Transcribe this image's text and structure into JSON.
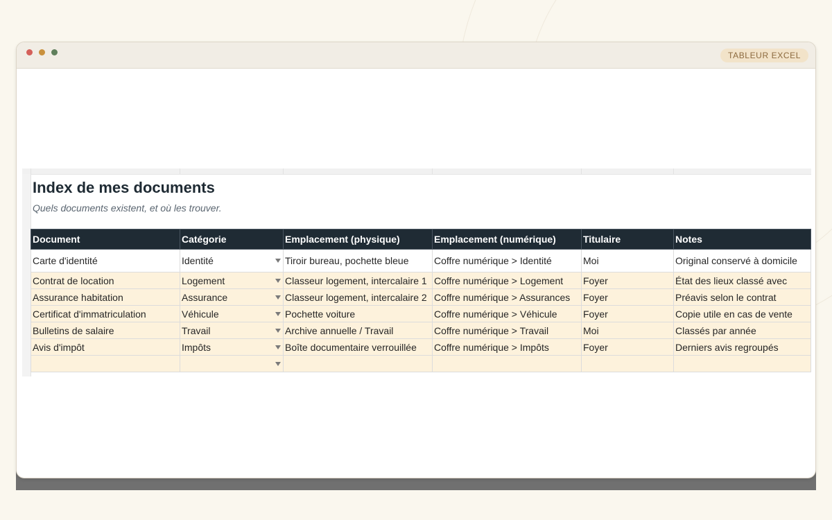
{
  "window": {
    "app_label": "TABLEUR EXCEL",
    "traffic_lights": {
      "close": "#d4605a",
      "minimize": "#c9913d",
      "zoom": "#5f7f5b"
    }
  },
  "sheet": {
    "title": "Index de mes documents",
    "subtitle": "Quels documents existent, et où les trouver.",
    "columns": [
      "Document",
      "Catégorie",
      "Emplacement (physique)",
      "Emplacement (numérique)",
      "Titulaire",
      "Notes"
    ],
    "rows": [
      [
        "Carte d'identité",
        "Identité",
        "Tiroir bureau, pochette bleue",
        "Coffre numérique > Identité",
        "Moi",
        "Original conservé à domicile"
      ],
      [
        "Contrat de location",
        "Logement",
        "Classeur logement, intercalaire 1",
        "Coffre numérique > Logement",
        "Foyer",
        "État des lieux classé avec"
      ],
      [
        "Assurance habitation",
        "Assurance",
        "Classeur logement, intercalaire 2",
        "Coffre numérique > Assurances",
        "Foyer",
        "Préavis selon le contrat"
      ],
      [
        "Certificat d'immatriculation",
        "Véhicule",
        "Pochette voiture",
        "Coffre numérique > Véhicule",
        "Foyer",
        "Copie utile en cas de vente"
      ],
      [
        "Bulletins de salaire",
        "Travail",
        "Archive annuelle / Travail",
        "Coffre numérique > Travail",
        "Moi",
        "Classés par année"
      ],
      [
        "Avis d'impôt",
        "Impôts",
        "Boîte documentaire verrouillée",
        "Coffre numérique > Impôts",
        "Foyer",
        "Derniers avis regroupés"
      ],
      [
        "",
        "",
        "",
        "",
        "",
        ""
      ]
    ],
    "colors": {
      "header_bg": "#1f2b34",
      "band_bg": "#fdf2dc",
      "title": "#1e2a33"
    }
  }
}
